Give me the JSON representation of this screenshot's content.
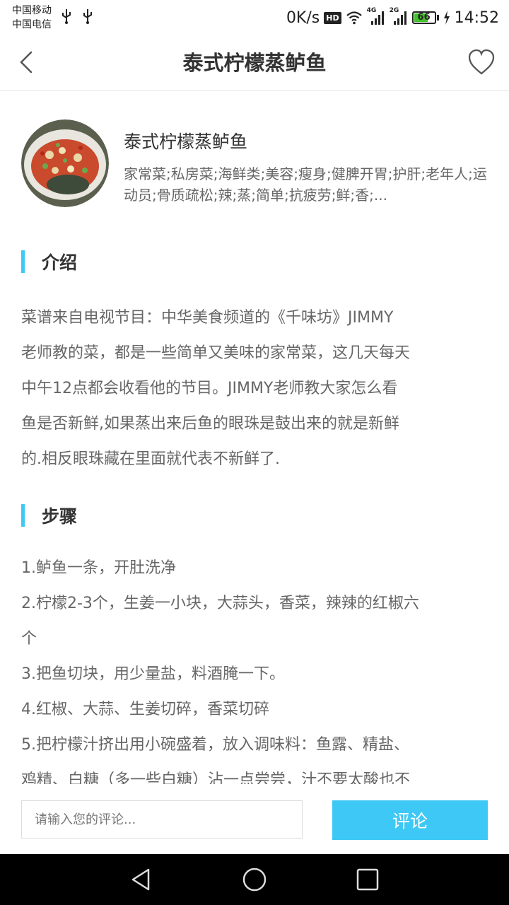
{
  "status_bar": {
    "carrier_1": "中国移动",
    "carrier_2": "中国电信",
    "net_speed": "0K/s",
    "hd_badge": "HD",
    "signal_1_tag": "4G",
    "signal_2_tag": "2G",
    "battery_level": "66",
    "time": "14:52"
  },
  "header": {
    "title": "泰式柠檬蒸鲈鱼",
    "back_icon": "chevron-left-icon",
    "fav_icon": "heart-outline-icon"
  },
  "dish": {
    "name": "泰式柠檬蒸鲈鱼",
    "tags": "家常菜;私房菜;海鲜类;美容;瘦身;健脾开胃;护肝;老年人;运动员;骨质疏松;辣;蒸;简单;抗疲劳;鲜;香;..."
  },
  "sections": {
    "intro_title": "介绍",
    "steps_title": "步骤"
  },
  "intro": {
    "lines": [
      "菜谱来自电视节目：中华美食频道的《千味坊》JIMMY",
      "老师教的菜，都是一些简单又美味的家常菜，这几天每天",
      "中午12点都会收看他的节目。JIMMY老师教大家怎么看",
      "鱼是否新鲜,如果蒸出来后鱼的眼珠是鼓出来的就是新鲜",
      "的.相反眼珠藏在里面就代表不新鲜了."
    ]
  },
  "steps": {
    "lines": [
      "1.鲈鱼一条，开肚洗净",
      "2.柠檬2-3个，生姜一小块，大蒜头，香菜，辣辣的红椒六",
      "个",
      "3.把鱼切块，用少量盐，料酒腌一下。",
      "4.红椒、大蒜、生姜切碎，香菜切碎",
      "5.把柠檬汁挤出用小碗盛着，放入调味料：鱼露、精盐、",
      "鸡精、白糖（多一些白糖）沾一点尝尝，汁不要太酸也不"
    ]
  },
  "comment": {
    "placeholder": "请输入您的评论...",
    "button_label": "评论"
  },
  "colors": {
    "accent": "#3ec8f5",
    "text_primary": "#333333",
    "text_secondary": "#666666"
  }
}
